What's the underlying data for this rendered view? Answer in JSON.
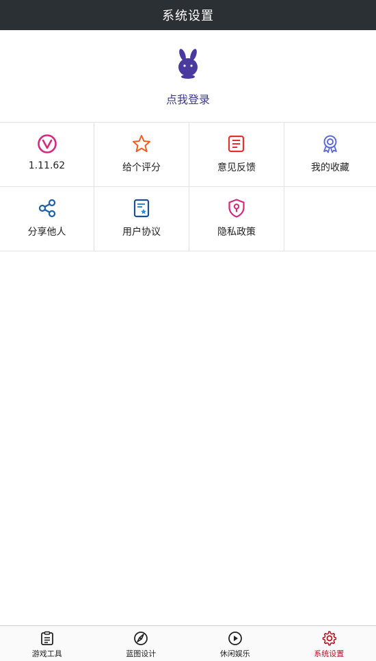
{
  "header": {
    "title": "系统设置"
  },
  "profile": {
    "login_text": "点我登录"
  },
  "grid": {
    "items": [
      {
        "label": "1.11.62",
        "icon": "vue-version-icon",
        "color": "#d4297d"
      },
      {
        "label": "给个评分",
        "icon": "star-icon",
        "color": "#f05a23"
      },
      {
        "label": "意见反馈",
        "icon": "feedback-icon",
        "color": "#e0322b"
      },
      {
        "label": "我的收藏",
        "icon": "award-icon",
        "color": "#5b6ad8"
      },
      {
        "label": "分享他人",
        "icon": "share-icon",
        "color": "#1c5fa8"
      },
      {
        "label": "用户协议",
        "icon": "agreement-icon",
        "color": "#1b4f8f"
      },
      {
        "label": "隐私政策",
        "icon": "privacy-shield-icon",
        "color": "#d4297d"
      }
    ]
  },
  "bottom_nav": {
    "items": [
      {
        "label": "游戏工具",
        "icon": "clipboard-icon"
      },
      {
        "label": "蓝图设计",
        "icon": "compass-icon"
      },
      {
        "label": "休闲娱乐",
        "icon": "play-icon"
      },
      {
        "label": "系统设置",
        "icon": "gear-icon",
        "active": true
      }
    ],
    "active_color": "#b01826"
  }
}
